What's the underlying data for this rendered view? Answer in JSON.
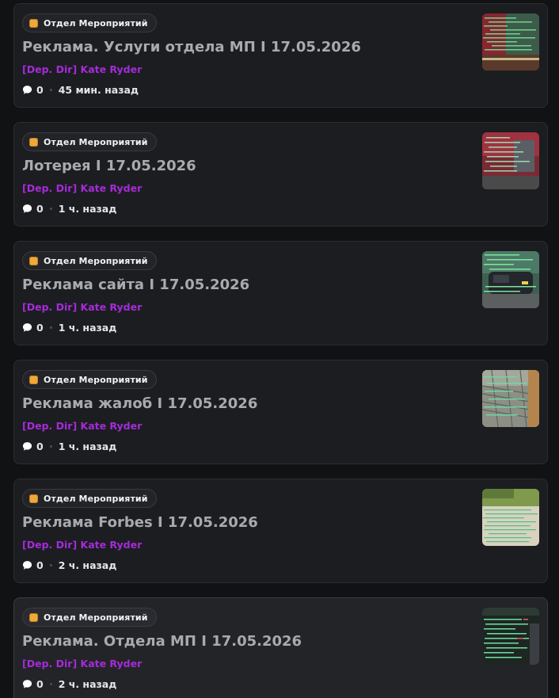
{
  "posts": [
    {
      "tag": "Отдел Мероприятий",
      "title": "Реклама. Услуги отдела МП I 17.05.2026",
      "author": "[Dep. Dir] Kate Ryder",
      "comments": "0",
      "time": "45 мин. назад",
      "thumbnail": "screenshot-green-text-red-building"
    },
    {
      "tag": "Отдел Мероприятий",
      "title": "Лотерея I 17.05.2026",
      "author": "[Dep. Dir] Kate Ryder",
      "comments": "0",
      "time": "1 ч. назад",
      "thumbnail": "screenshot-red-building"
    },
    {
      "tag": "Отдел Мероприятий",
      "title": "Реклама сайта I 17.05.2026",
      "author": "[Dep. Dir] Kate Ryder",
      "comments": "0",
      "time": "1 ч. назад",
      "thumbnail": "screenshot-dark-car"
    },
    {
      "tag": "Отдел Мероприятий",
      "title": "Реклама жалоб I 17.05.2026",
      "author": "[Dep. Dir] Kate Ryder",
      "comments": "0",
      "time": "1 ч. назад",
      "thumbnail": "screenshot-fence"
    },
    {
      "tag": "Отдел Мероприятий",
      "title": "Реклама Forbes I 17.05.2026",
      "author": "[Dep. Dir] Kate Ryder",
      "comments": "0",
      "time": "2 ч. назад",
      "thumbnail": "screenshot-light-wall"
    },
    {
      "tag": "Отдел Мероприятий",
      "title": "Реклама. Отдела МП I 17.05.2026",
      "author": "[Dep. Dir] Kate Ryder",
      "comments": "0",
      "time": "2 ч. назад",
      "thumbnail": "screenshot-dark-chat"
    }
  ],
  "colors": {
    "background": "#111214",
    "card": "#1c1d21",
    "tag_icon": "#f0a83a",
    "author": "#a52bd9",
    "title": "#a9aab0"
  },
  "icons": {
    "tag": "orange-square-icon",
    "comments": "speech-bubble-icon"
  }
}
